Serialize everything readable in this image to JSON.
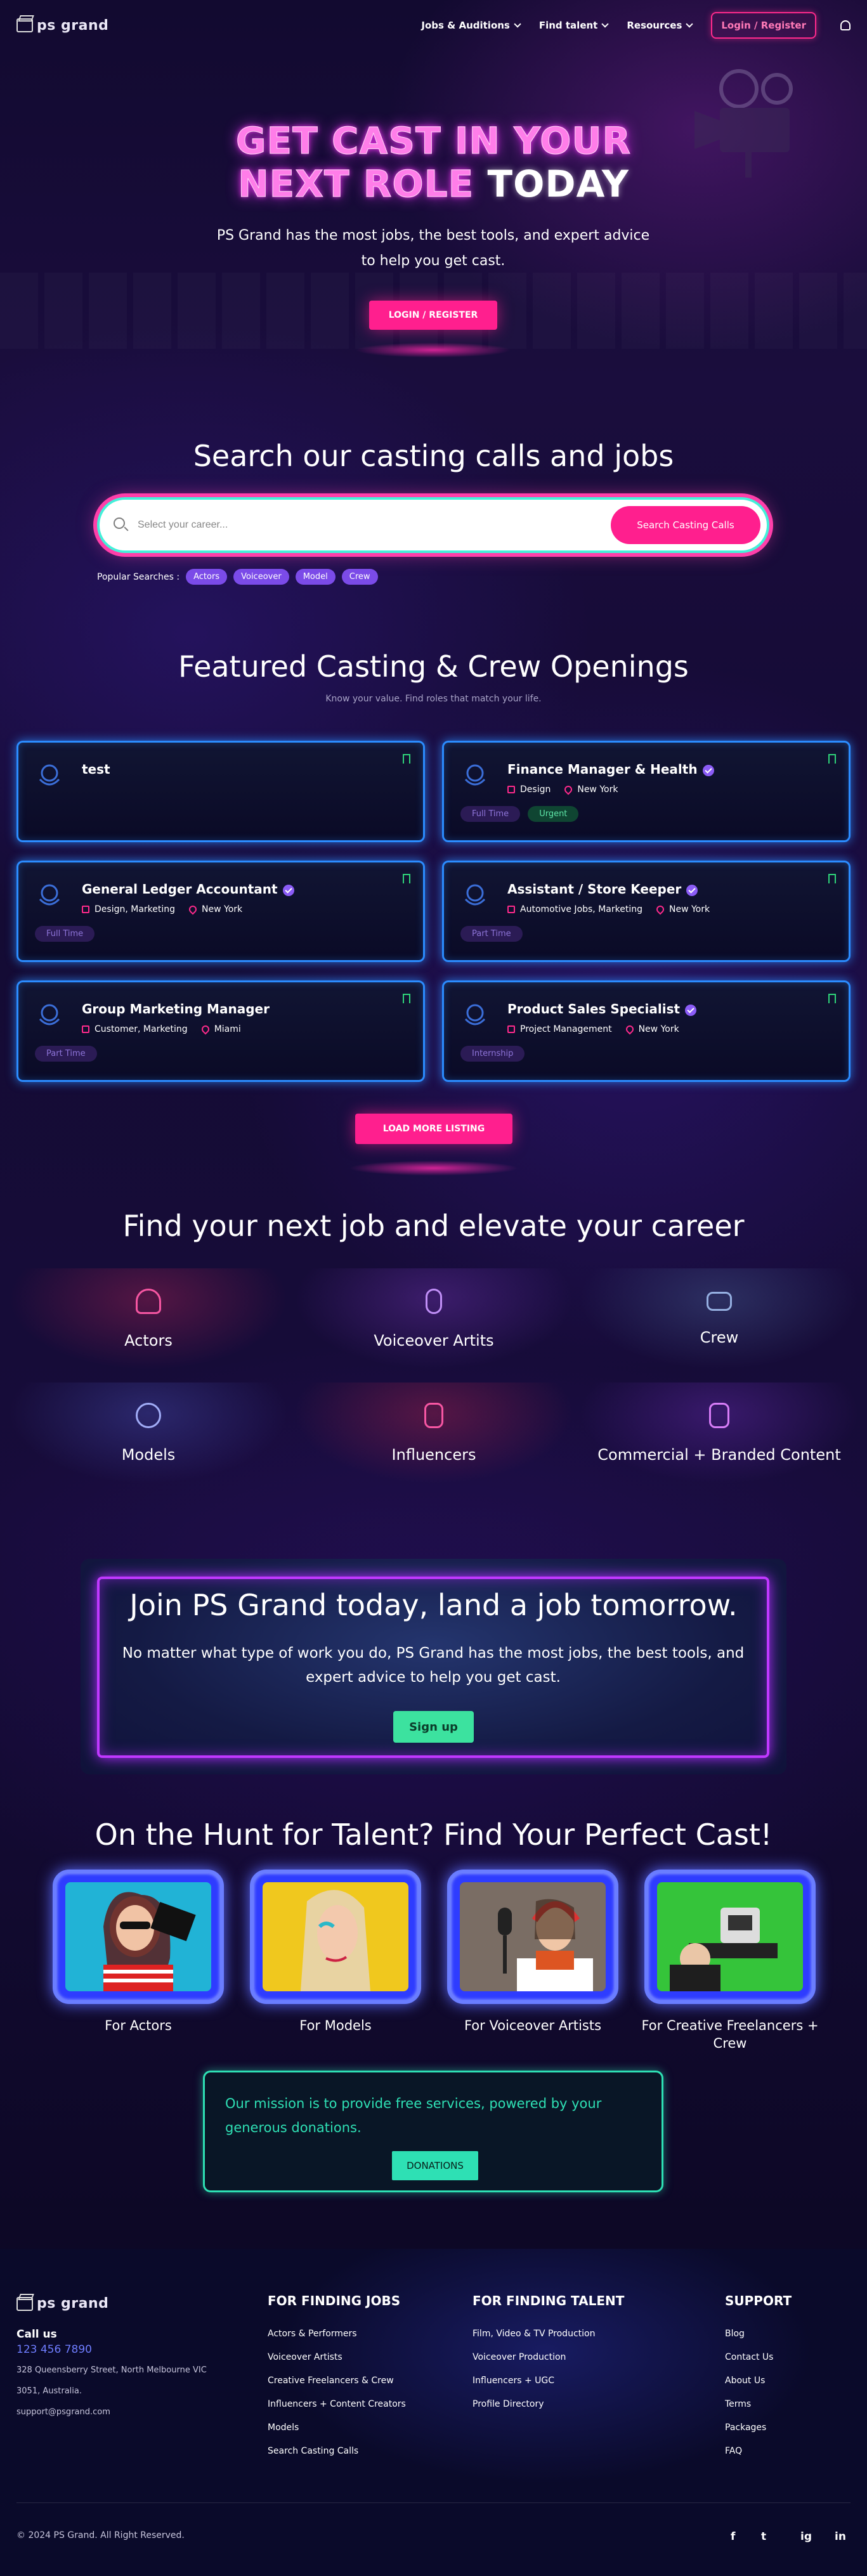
{
  "header": {
    "logo_text": "ps grand",
    "nav": [
      "Jobs & Auditions",
      "Find talent",
      "Resources"
    ],
    "login_label": "Login / Register"
  },
  "hero": {
    "line1_pink": "GET CAST IN YOUR",
    "line2_pink": "NEXT ROLE",
    "line2_white": "TODAY",
    "subtitle": "PS Grand has the most jobs, the best tools, and expert advice to help you get cast.",
    "button": "LOGIN / REGISTER"
  },
  "search": {
    "title": "Search our casting calls and jobs",
    "placeholder": "Select your career...",
    "button": "Search Casting Calls",
    "popular_label": "Popular Searches :",
    "chips": [
      "Actors",
      "Voiceover",
      "Model",
      "Crew"
    ]
  },
  "featured": {
    "title": "Featured Casting & Crew Openings",
    "subtitle": "Know your value. Find roles that match your life.",
    "load_more": "LOAD MORE LISTING",
    "jobs": [
      {
        "title": "test",
        "verified": false,
        "category": "",
        "location": "",
        "tags": []
      },
      {
        "title": "Finance Manager & Health",
        "verified": true,
        "category": "Design",
        "location": "New York",
        "tags": [
          "Full Time",
          "Urgent"
        ]
      },
      {
        "title": "General Ledger Accountant",
        "verified": true,
        "category": "Design, Marketing",
        "location": "New York",
        "tags": [
          "Full Time"
        ]
      },
      {
        "title": "Assistant / Store Keeper",
        "verified": true,
        "category": "Automotive Jobs, Marketing",
        "location": "New York",
        "tags": [
          "Part Time"
        ]
      },
      {
        "title": "Group Marketing Manager",
        "verified": false,
        "category": "Customer, Marketing",
        "location": "Miami",
        "tags": [
          "Part Time"
        ]
      },
      {
        "title": "Product Sales Specialist",
        "verified": true,
        "category": "Project Management",
        "location": "New York",
        "tags": [
          "Internship"
        ]
      }
    ]
  },
  "categories": {
    "title": "Find your next job and elevate your career",
    "items": [
      "Actors",
      "Voiceover Artits",
      "Crew",
      "Models",
      "Influencers",
      "Commercial + Branded Content"
    ]
  },
  "cta": {
    "title": "Join PS Grand today, land a job tomorrow.",
    "text": "No matter what type of work you do, PS Grand has the most jobs, the best tools, and expert advice to help you get cast.",
    "button": "Sign up"
  },
  "talent": {
    "title": "On the Hunt for Talent? Find Your Perfect Cast!",
    "items": [
      "For Actors",
      "For Models",
      "For Voiceover Artists",
      "For Creative Freelancers + Crew"
    ]
  },
  "mission": {
    "text": "Our mission is to provide free services, powered by your generous donations.",
    "button": "DONATIONS"
  },
  "footer": {
    "logo_text": "ps grand",
    "call_label": "Call us",
    "phone": "123 456 7890",
    "address1": "328 Queensberry Street, North Melbourne VIC",
    "address2": "3051, Australia.",
    "email": "support@psgrand.com",
    "col1": {
      "title": "FOR FINDING JOBS",
      "links": [
        "Actors & Performers",
        "Voiceover Artists",
        "Creative Freelancers & Crew",
        "Influencers + Content Creators",
        "Models",
        "Search Casting Calls"
      ]
    },
    "col2": {
      "title": "FOR FINDING TALENT",
      "links": [
        "Film, Video & TV Production",
        "Voiceover Production",
        "Influencers + UGC",
        "Profile Directory"
      ]
    },
    "col3": {
      "title": "SUPPORT",
      "links": [
        "Blog",
        "Contact Us",
        "About Us",
        "Terms",
        "Packages",
        "FAQ"
      ]
    },
    "copyright": "© 2024 PS Grand. All Right Reserved.",
    "social": [
      "f",
      "t",
      "ig",
      "in"
    ]
  },
  "colors": {
    "pink": "#ff1f8e",
    "neon_blue": "#2b8cff",
    "teal": "#2ee0b4",
    "purple": "#c038ff",
    "green": "#3ce29f"
  }
}
